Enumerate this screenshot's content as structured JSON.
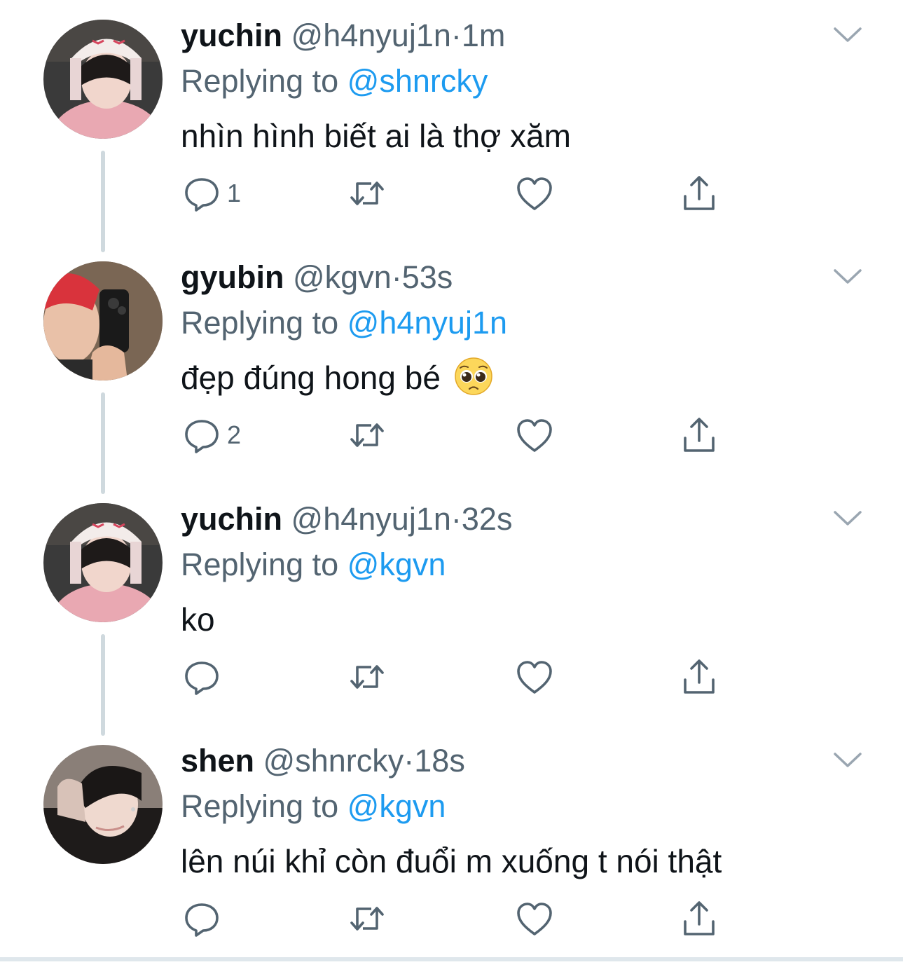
{
  "icons": {
    "reply": "reply-icon",
    "retweet": "retweet-icon",
    "like": "heart-icon",
    "share": "share-icon",
    "more": "chevron-down-icon"
  },
  "colors": {
    "link": "#1d9bf0",
    "secondary_text": "#536471",
    "primary_text": "#0f1419",
    "thread_line": "#cfd9de"
  },
  "tweets": [
    {
      "name": "yuchin",
      "handle": "@h4nyuj1n",
      "separator": "·",
      "time": "1m",
      "replying_prefix": "Replying to",
      "replying_to": "@shnrcky",
      "text": "nhìn hình biết ai là thợ xăm",
      "reply_count": "1"
    },
    {
      "name": "gyubin",
      "handle": "@kgvn",
      "separator": "·",
      "time": "53s",
      "replying_prefix": "Replying to",
      "replying_to": "@h4nyuj1n",
      "text": "đẹp đúng hong bé",
      "emoji": "pleading-face-emoji",
      "reply_count": "2"
    },
    {
      "name": "yuchin",
      "handle": "@h4nyuj1n",
      "separator": "·",
      "time": "32s",
      "replying_prefix": "Replying to",
      "replying_to": "@kgvn",
      "text": "ko",
      "reply_count": ""
    },
    {
      "name": "shen",
      "handle": "@shnrcky",
      "separator": "·",
      "time": "18s",
      "replying_prefix": "Replying to",
      "replying_to": "@kgvn",
      "text": "lên núi khỉ còn đuổi m xuống t nói thật",
      "reply_count": ""
    }
  ]
}
